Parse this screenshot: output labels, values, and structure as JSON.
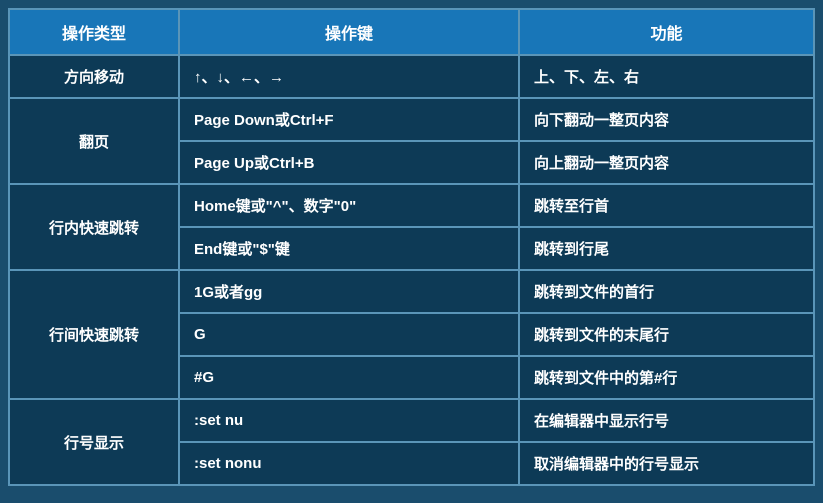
{
  "headers": {
    "type": "操作类型",
    "key": "操作键",
    "func": "功能"
  },
  "groups": [
    {
      "category": "方向移动",
      "rows": [
        {
          "key": "↑、↓、←、→",
          "func": "上、下、左、右"
        }
      ]
    },
    {
      "category": "翻页",
      "rows": [
        {
          "key": "Page Down或Ctrl+F",
          "func": "向下翻动一整页内容"
        },
        {
          "key": "Page Up或Ctrl+B",
          "func": "向上翻动一整页内容"
        }
      ]
    },
    {
      "category": "行内快速跳转",
      "rows": [
        {
          "key": "Home键或\"^\"、数字\"0\"",
          "func": "跳转至行首"
        },
        {
          "key": "End键或\"$\"键",
          "func": "跳转到行尾"
        }
      ]
    },
    {
      "category": "行间快速跳转",
      "rows": [
        {
          "key": "1G或者gg",
          "func": "跳转到文件的首行"
        },
        {
          "key": "G",
          "func": "跳转到文件的末尾行"
        },
        {
          "key": "#G",
          "func": "跳转到文件中的第#行"
        }
      ]
    },
    {
      "category": "行号显示",
      "rows": [
        {
          "key": ":set nu",
          "func": "在编辑器中显示行号"
        },
        {
          "key": ":set nonu",
          "func": "取消编辑器中的行号显示"
        }
      ]
    }
  ]
}
